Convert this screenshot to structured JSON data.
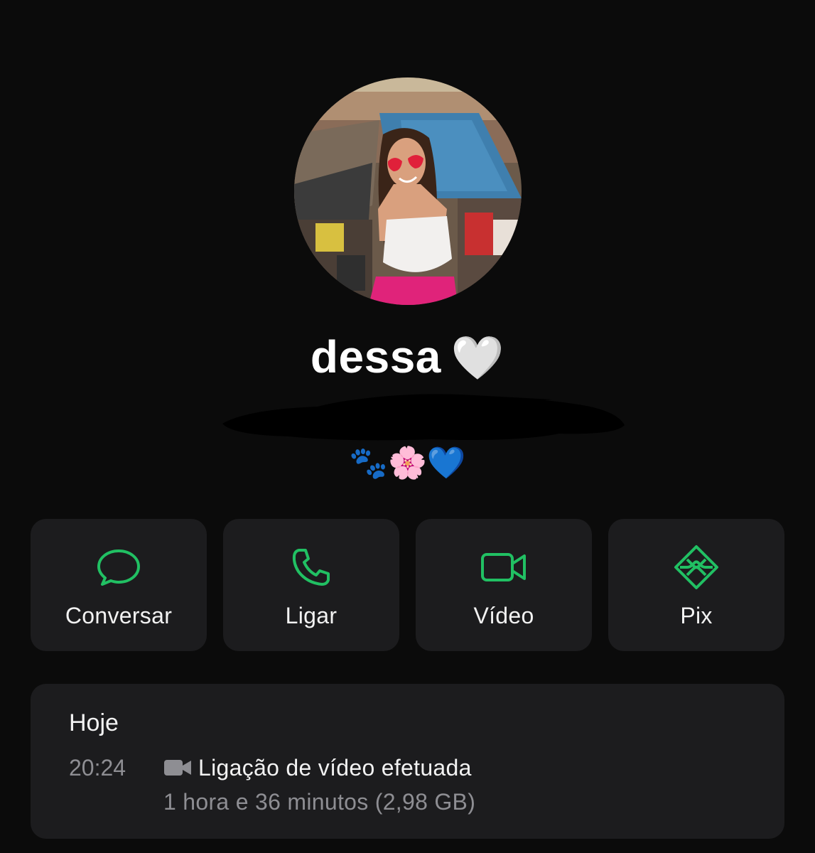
{
  "contact": {
    "name": "dessa",
    "name_emoji": "🤍",
    "status_emojis": {
      "paws": "🐾",
      "flower": "🌸",
      "heart": "💙"
    }
  },
  "actions": [
    {
      "label": "Conversar",
      "icon": "chat-bubble-icon"
    },
    {
      "label": "Ligar",
      "icon": "phone-icon"
    },
    {
      "label": "Vídeo",
      "icon": "video-camera-icon"
    },
    {
      "label": "Pix",
      "icon": "pix-icon"
    }
  ],
  "history": {
    "day": "Hoje",
    "entries": [
      {
        "time": "20:24",
        "icon": "video-camera-icon",
        "description": "Ligação de vídeo efetuada",
        "duration": "1 hora e 36 minutos (2,98 GB)"
      }
    ]
  },
  "colors": {
    "background": "#0b0b0b",
    "card": "#1c1c1e",
    "accent": "#21c063",
    "secondary_text": "#8e8e93"
  }
}
